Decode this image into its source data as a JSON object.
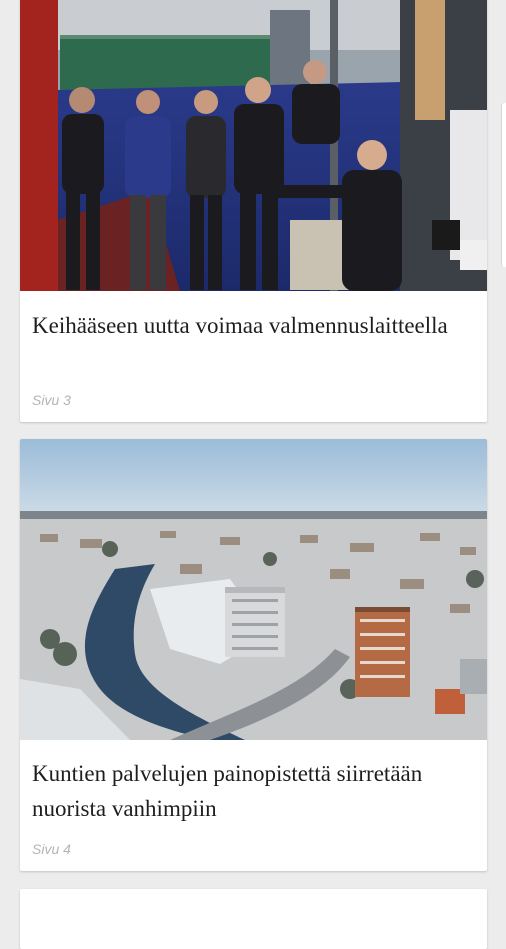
{
  "articles": [
    {
      "title": "Keihääseen uutta voimaa valmennuslaitteella",
      "page": "Sivu 3",
      "image": "photo-coaches-throwing-device"
    },
    {
      "title": "Kuntien palvelujen painopistettä siirretään nuorista vanhimpiin",
      "page": "Sivu 4",
      "image": "photo-aerial-winter-town"
    }
  ],
  "colors": {
    "background": "#ececec",
    "card": "#ffffff",
    "title": "#1e1e1e",
    "page_label": "#b4b4b4"
  }
}
